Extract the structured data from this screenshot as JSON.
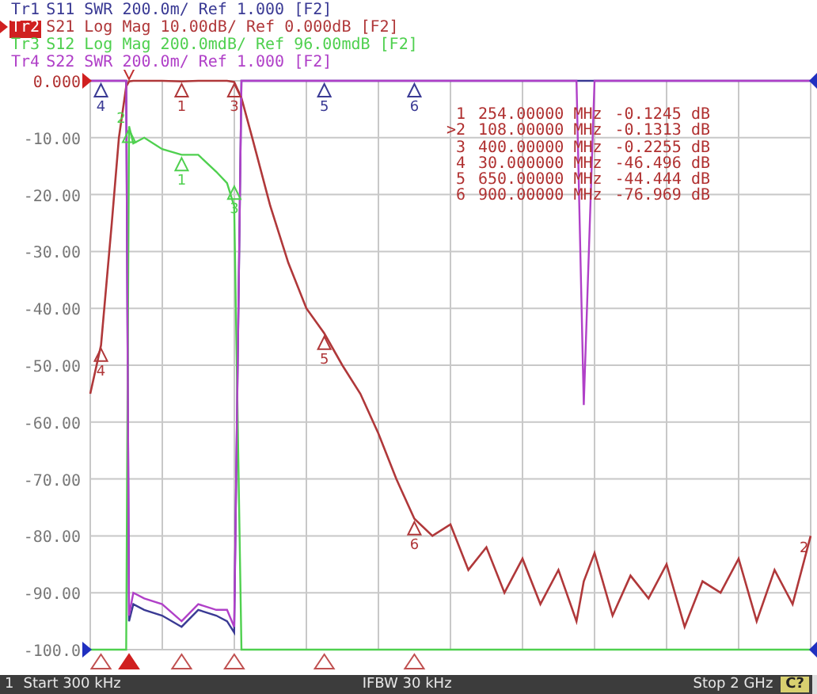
{
  "traces": [
    {
      "name": "Tr1",
      "param": "S11",
      "format": "SWR",
      "scale": "200.0m/",
      "ref": "Ref 1.000",
      "channel": "[F2]",
      "color": "#3a3a94",
      "selected": false,
      "markers": [
        {
          "label": "4"
        },
        {
          "label": "5"
        },
        {
          "label": "6"
        }
      ]
    },
    {
      "name": "Tr2",
      "param": "S21",
      "format": "Log Mag",
      "scale": "10.00dB/",
      "ref": "Ref 0.000dB",
      "channel": "[F2]",
      "color": "#b0383a",
      "selected": true,
      "markers": [
        {
          "label": "1"
        },
        {
          "label": "3"
        },
        {
          "label": "4"
        },
        {
          "label": "5"
        },
        {
          "label": "6"
        }
      ]
    },
    {
      "name": "Tr3",
      "param": "S12",
      "format": "Log Mag",
      "scale": "200.0mdB/",
      "ref": "Ref 96.00mdB",
      "channel": "[F2]",
      "color": "#4fd04f",
      "selected": false,
      "markers": [
        {
          "label": "1"
        },
        {
          "label": "2"
        },
        {
          "label": "3"
        }
      ]
    },
    {
      "name": "Tr4",
      "param": "S22",
      "format": "SWR",
      "scale": "200.0m/",
      "ref": "Ref 1.000",
      "channel": "[F2]",
      "color": "#b040c8",
      "selected": false
    }
  ],
  "readout": [
    {
      "label": "1",
      "stimulus": "254.00000 MHz",
      "response": "-0.1245 dB"
    },
    {
      "label": ">2",
      "stimulus": "108.00000 MHz",
      "response": "-0.1313 dB"
    },
    {
      "label": "3",
      "stimulus": "400.00000 MHz",
      "response": "-0.2255 dB"
    },
    {
      "label": "4",
      "stimulus": "30.000000 MHz",
      "response": "-46.496 dB"
    },
    {
      "label": "5",
      "stimulus": "650.00000 MHz",
      "response": "-44.444 dB"
    },
    {
      "label": "6",
      "stimulus": "900.00000 MHz",
      "response": "-76.969 dB"
    }
  ],
  "plot": {
    "y_labels": [
      "0.000",
      "-10.00",
      "-20.00",
      "-30.00",
      "-40.00",
      "-50.00",
      "-60.00",
      "-70.00",
      "-80.00",
      "-90.00",
      "-100.0"
    ],
    "stimulus_markers": [
      {
        "active": false
      },
      {
        "active": true
      },
      {
        "active": false
      },
      {
        "active": false
      },
      {
        "active": false
      },
      {
        "active": false
      }
    ],
    "right_edge_label": "2"
  },
  "status_bar": {
    "channel": "1",
    "start": "Start 300 kHz",
    "ifbw": "IFBW 30 kHz",
    "stop": "Stop 2 GHz",
    "badge": "C?"
  }
}
